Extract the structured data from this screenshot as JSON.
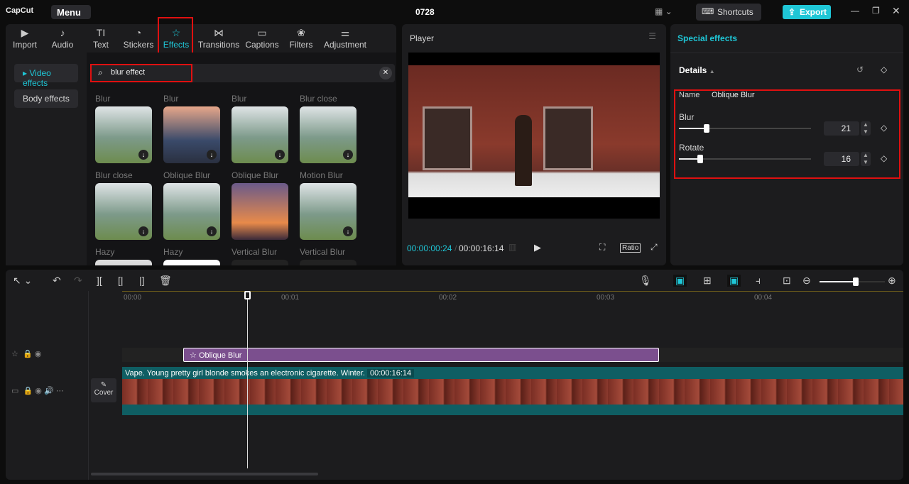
{
  "app": {
    "logo": "CapCut",
    "menu": "Menu",
    "title": "0728",
    "shortcuts": "Shortcuts",
    "export": "Export"
  },
  "tabs": [
    {
      "label": "Import",
      "icon": "import-icon"
    },
    {
      "label": "Audio",
      "icon": "audio-icon"
    },
    {
      "label": "Text",
      "icon": "text-icon"
    },
    {
      "label": "Stickers",
      "icon": "stickers-icon"
    },
    {
      "label": "Effects",
      "icon": "effects-icon"
    },
    {
      "label": "Transitions",
      "icon": "transitions-icon"
    },
    {
      "label": "Captions",
      "icon": "captions-icon"
    },
    {
      "label": "Filters",
      "icon": "filters-icon"
    },
    {
      "label": "Adjustment",
      "icon": "adjustment-icon"
    }
  ],
  "sidebar": {
    "video_effects": "Video effects",
    "body_effects": "Body effects"
  },
  "search": {
    "value": "blur effect"
  },
  "effects": [
    "Blur",
    "Blur",
    "Blur",
    "Blur close",
    "Blur close",
    "Oblique Blur",
    "Oblique Blur",
    "Motion Blur",
    "Hazy",
    "Hazy",
    "Vertical Blur",
    "Vertical Blur"
  ],
  "player": {
    "title": "Player",
    "current": "00:00:00:24",
    "total": "00:00:16:14",
    "ratio": "Ratio"
  },
  "special": {
    "title": "Special effects",
    "details": "Details",
    "name_label": "Name",
    "name_value": "Oblique Blur",
    "params": [
      {
        "label": "Blur",
        "value": "21",
        "fraction": 0.21
      },
      {
        "label": "Rotate",
        "value": "16",
        "fraction": 0.16
      }
    ]
  },
  "timeline": {
    "ticks": [
      "00:00",
      "00:01",
      "00:02",
      "00:03",
      "00:04"
    ],
    "effect_clip": "Oblique Blur",
    "video_clip": "Vape. Young pretty girl blonde smokes an electronic cigarette. Winter.",
    "video_duration": "00:00:16:14",
    "cover": "Cover",
    "zoom_fraction": 0.55
  },
  "colors": {
    "accent": "#1fc6d6",
    "effect_clip": "#7b4f8e",
    "video_clip": "#0f5e63",
    "highlight": "#e01010"
  }
}
